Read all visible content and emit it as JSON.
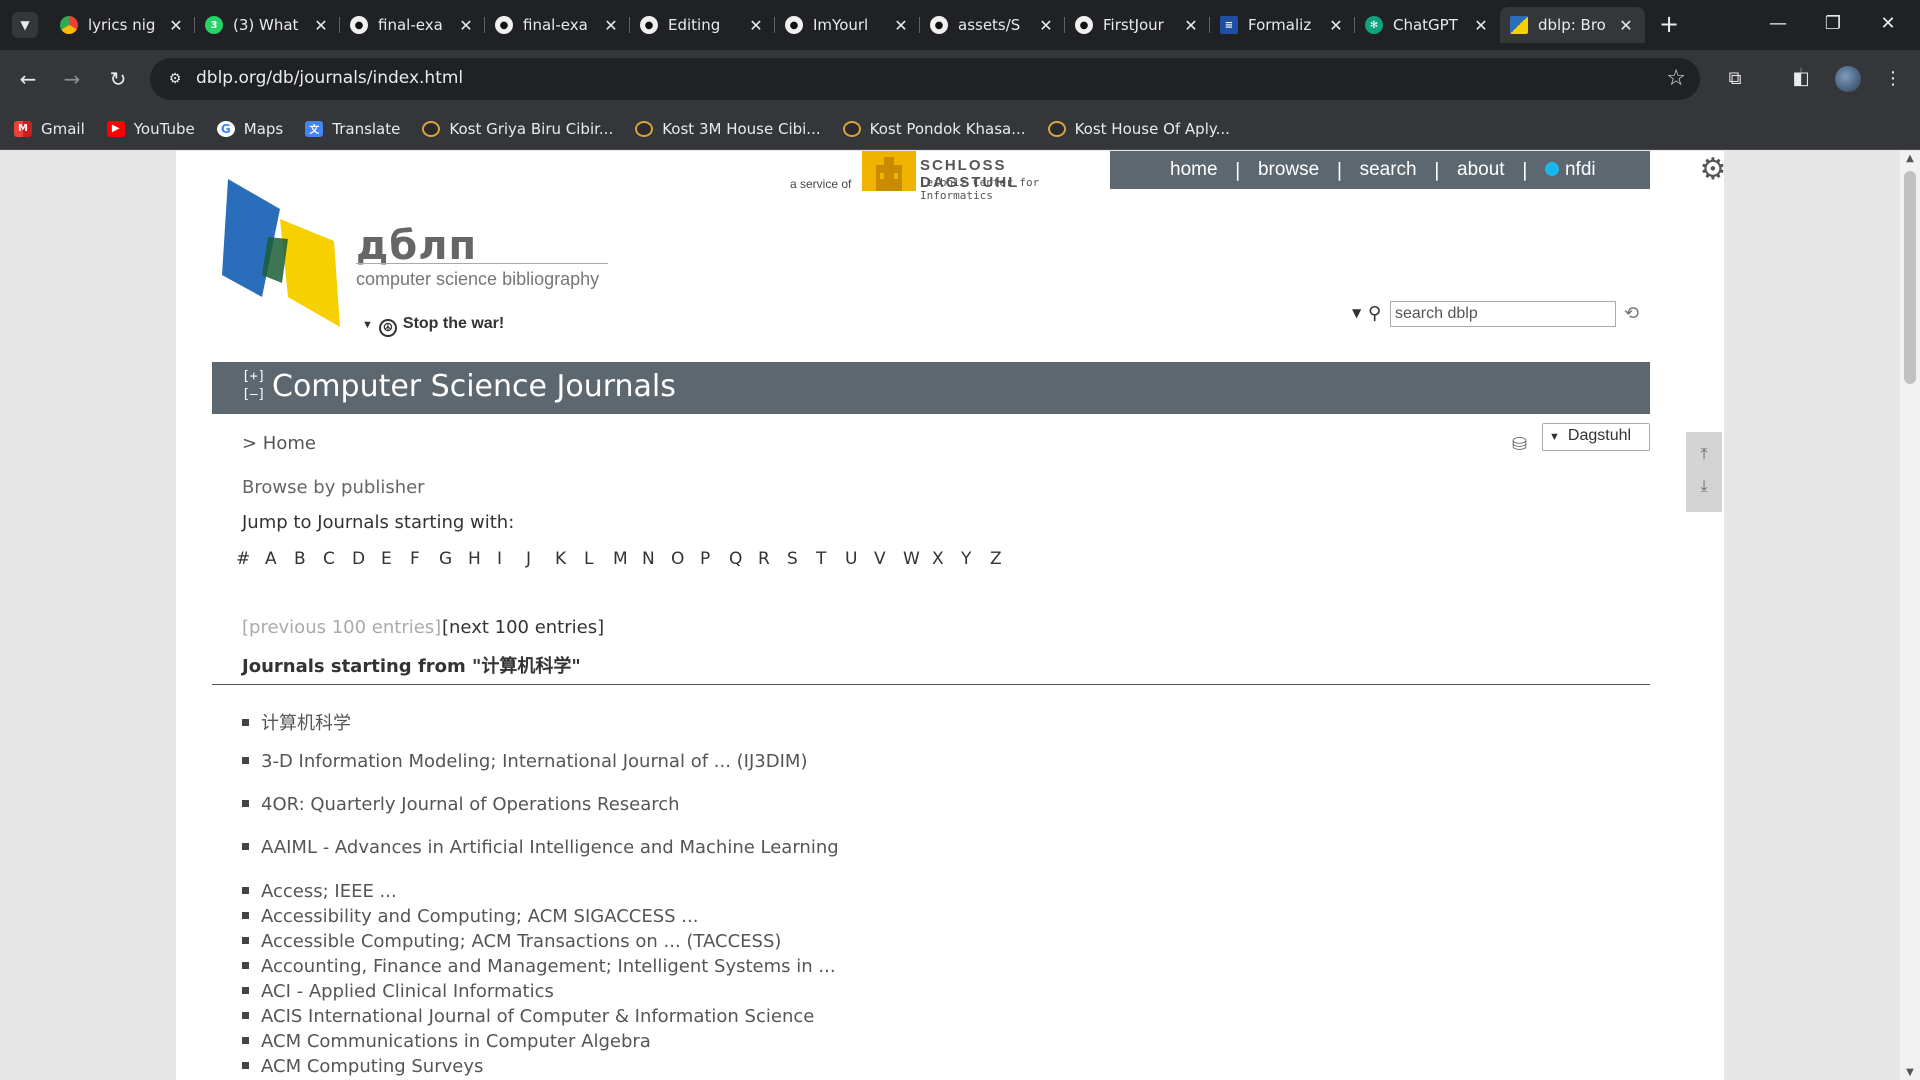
{
  "browser": {
    "tabs": [
      {
        "title": "lyrics nig",
        "icon": "chrome-icon"
      },
      {
        "title": "(3) What",
        "icon": "whatsapp-icon"
      },
      {
        "title": "final-exa",
        "icon": "github-icon"
      },
      {
        "title": "final-exa",
        "icon": "github-icon"
      },
      {
        "title": "Editing",
        "icon": "github-icon"
      },
      {
        "title": "ImYourl",
        "icon": "github-icon"
      },
      {
        "title": "assets/S",
        "icon": "github-icon"
      },
      {
        "title": "FirstJour",
        "icon": "github-icon"
      },
      {
        "title": "Formaliz",
        "icon": "ieee-icon"
      },
      {
        "title": "ChatGPT",
        "icon": "chatgpt-icon"
      },
      {
        "title": "dblp: Bro",
        "icon": "dblp-icon",
        "active": true
      }
    ],
    "url": "dblp.org/db/journals/index.html",
    "bookmarks": [
      {
        "label": "Gmail"
      },
      {
        "label": "YouTube"
      },
      {
        "label": "Maps"
      },
      {
        "label": "Translate"
      },
      {
        "label": "Kost Griya Biru Cibir..."
      },
      {
        "label": "Kost 3M House Cibi..."
      },
      {
        "label": "Kost Pondok Khasa..."
      },
      {
        "label": "Kost House Of Aply..."
      }
    ]
  },
  "dblp": {
    "service_of": "a service of",
    "dagstuhl_name": "SCHLOSS DAGSTUHL",
    "dagstuhl_sub": "Leibniz Center for Informatics",
    "nav": {
      "home": "home",
      "browse": "browse",
      "search": "search",
      "about": "about",
      "nfdi": "nfdi"
    },
    "logo_text": "дблп",
    "logo_sub": "computer science bibliography",
    "stop_war": "Stop the war!",
    "search_placeholder": "search dblp",
    "expand": "[+]",
    "collapse": "[–]",
    "heading": "Computer Science Journals",
    "breadcrumb": "> Home",
    "mirror": "Dagstuhl",
    "browse_publisher": "Browse by publisher",
    "jump_label": "Jump to Journals starting with:",
    "letters": [
      "#",
      "A",
      "B",
      "C",
      "D",
      "E",
      "F",
      "G",
      "H",
      "I",
      "J",
      "K",
      "L",
      "M",
      "N",
      "O",
      "P",
      "Q",
      "R",
      "S",
      "T",
      "U",
      "V",
      "W",
      "X",
      "Y",
      "Z"
    ],
    "prev_entries": "[previous 100 entries]",
    "next_entries": "[next 100 entries]",
    "starting_from": "Journals starting from \"计算机科学\"",
    "journals": [
      "计算机科学",
      "3-D Information Modeling; International Journal of ... (IJ3DIM)",
      "4OR: Quarterly Journal of Operations Research",
      "AAIML - Advances in Artificial Intelligence and Machine Learning",
      "Access; IEEE ...",
      "Accessibility and Computing; ACM SIGACCESS ...",
      "Accessible Computing; ACM Transactions on ... (TACCESS)",
      "Accounting, Finance and Management; Intelligent Systems in ...",
      "ACI - Applied Clinical Informatics",
      "ACIS International Journal of Computer & Information Science",
      "ACM Communications in Computer Algebra",
      "ACM Computing Surveys"
    ]
  },
  "colors": {
    "nav_bar": "#5d6770",
    "dagstuhl": "#f0b400",
    "nfdi": "#1ab7ea"
  }
}
